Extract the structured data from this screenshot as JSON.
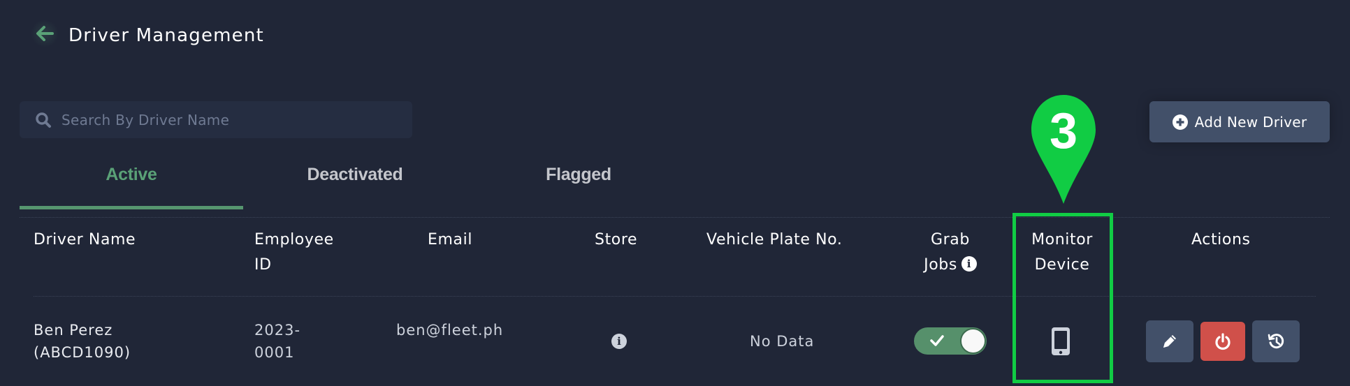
{
  "header": {
    "back_icon": "arrow-left-icon",
    "title": "Driver Management"
  },
  "search": {
    "icon": "search-icon",
    "placeholder": "Search By Driver Name",
    "value": ""
  },
  "add_button": {
    "icon": "plus-circle-icon",
    "label": "Add New Driver"
  },
  "tabs": [
    {
      "label": "Active",
      "active": true
    },
    {
      "label": "Deactivated",
      "active": false
    },
    {
      "label": "Flagged",
      "active": false
    }
  ],
  "table": {
    "columns": [
      {
        "line1": "Driver Name",
        "line2": ""
      },
      {
        "line1": "Employee",
        "line2": "ID"
      },
      {
        "line1": "Email",
        "line2": ""
      },
      {
        "line1": "Store",
        "line2": ""
      },
      {
        "line1": "Vehicle Plate No.",
        "line2": ""
      },
      {
        "line1": "Grab",
        "line2": "Jobs",
        "info_icon": "info-icon"
      },
      {
        "line1": "Monitor",
        "line2": "Device"
      },
      {
        "line1": "Actions",
        "line2": ""
      }
    ],
    "rows": [
      {
        "driver_name": "Ben Perez",
        "driver_code": "(ABCD1090)",
        "employee_id_line1": "2023-",
        "employee_id_line2": "0001",
        "email": "ben@fleet.ph",
        "store_icon": "info-icon",
        "vehicle_plate": "No Data",
        "grab_jobs_enabled": true,
        "monitor_device_icon": "mobile-phone-icon",
        "actions": [
          {
            "name": "edit",
            "icon": "pencil-icon"
          },
          {
            "name": "deactivate",
            "icon": "power-icon"
          },
          {
            "name": "history",
            "icon": "history-icon"
          }
        ]
      }
    ]
  },
  "annotation": {
    "step_number": "3",
    "target": "Monitor Device"
  },
  "colors": {
    "background": "#202637",
    "accent_green": "#5aa177",
    "button_slate": "#425069",
    "danger_red": "#d0504a",
    "annotation_green": "#11cc44"
  }
}
